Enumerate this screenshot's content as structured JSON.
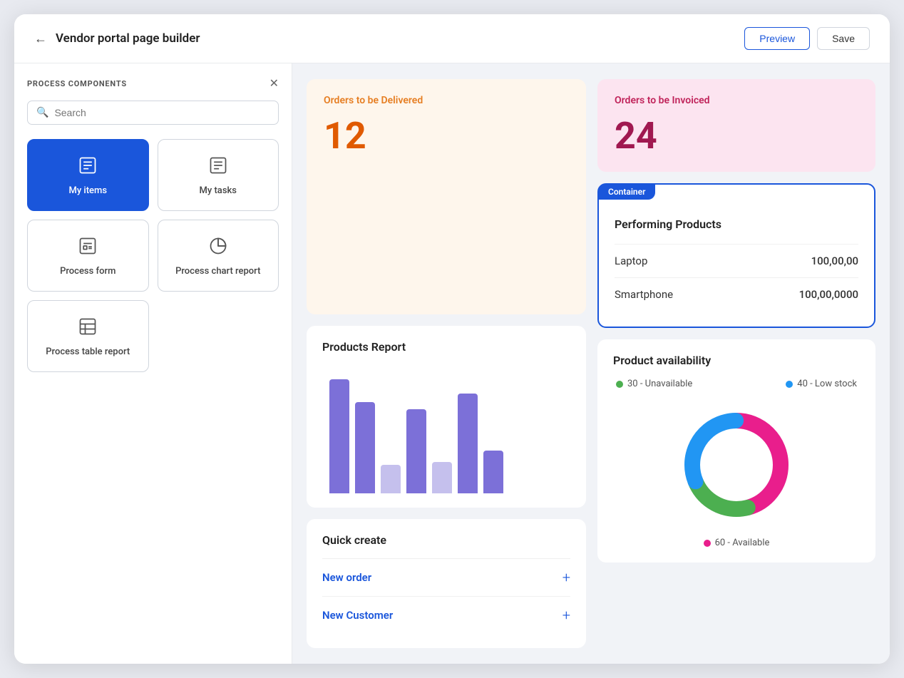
{
  "header": {
    "back_label": "←",
    "title": "Vendor portal page builder",
    "preview_label": "Preview",
    "save_label": "Save"
  },
  "sidebar": {
    "section_title": "PROCESS COMPONENTS",
    "close_icon": "✕",
    "search": {
      "placeholder": "Search"
    },
    "components": [
      {
        "id": "my-items",
        "label": "My items",
        "icon": "☰",
        "active": true
      },
      {
        "id": "my-tasks",
        "label": "My tasks",
        "icon": "☰",
        "active": false
      },
      {
        "id": "process-form",
        "label": "Process form",
        "icon": "⊟",
        "active": false
      },
      {
        "id": "process-chart-report",
        "label": "Process chart report",
        "icon": "◎",
        "active": false
      },
      {
        "id": "process-table-report",
        "label": "Process table report",
        "icon": "▤",
        "active": false
      }
    ]
  },
  "canvas": {
    "kpi_deliver": {
      "label": "Orders to be Delivered",
      "value": "12"
    },
    "kpi_invoice": {
      "label": "Orders to be Invoiced",
      "value": "24"
    },
    "products_report": {
      "title": "Products Report",
      "bars": [
        {
          "dark": 160,
          "light": 0
        },
        {
          "dark": 130,
          "light": 0
        },
        {
          "dark": 40,
          "light": 0
        },
        {
          "dark": 120,
          "light": 0
        },
        {
          "dark": 45,
          "light": 0
        },
        {
          "dark": 140,
          "light": 0
        },
        {
          "dark": 60,
          "light": 0
        }
      ]
    },
    "quick_create": {
      "title": "Quick create",
      "items": [
        {
          "label": "New order",
          "plus": "+"
        },
        {
          "label": "New Customer",
          "plus": "+"
        }
      ]
    },
    "performing_products": {
      "container_badge": "Container",
      "title": "Performing Products",
      "rows": [
        {
          "product": "Laptop",
          "value": "100,00,00"
        },
        {
          "product": "Smartphone",
          "value": "100,00,0000"
        }
      ]
    },
    "product_availability": {
      "title": "Product availability",
      "legend": [
        {
          "color": "green",
          "label": "30 - Unavailable"
        },
        {
          "color": "blue",
          "label": "40 - Low stock"
        },
        {
          "color": "pink",
          "label": "60 - Available"
        }
      ],
      "donut": {
        "green_pct": 23,
        "blue_pct": 31,
        "pink_pct": 46
      }
    }
  }
}
